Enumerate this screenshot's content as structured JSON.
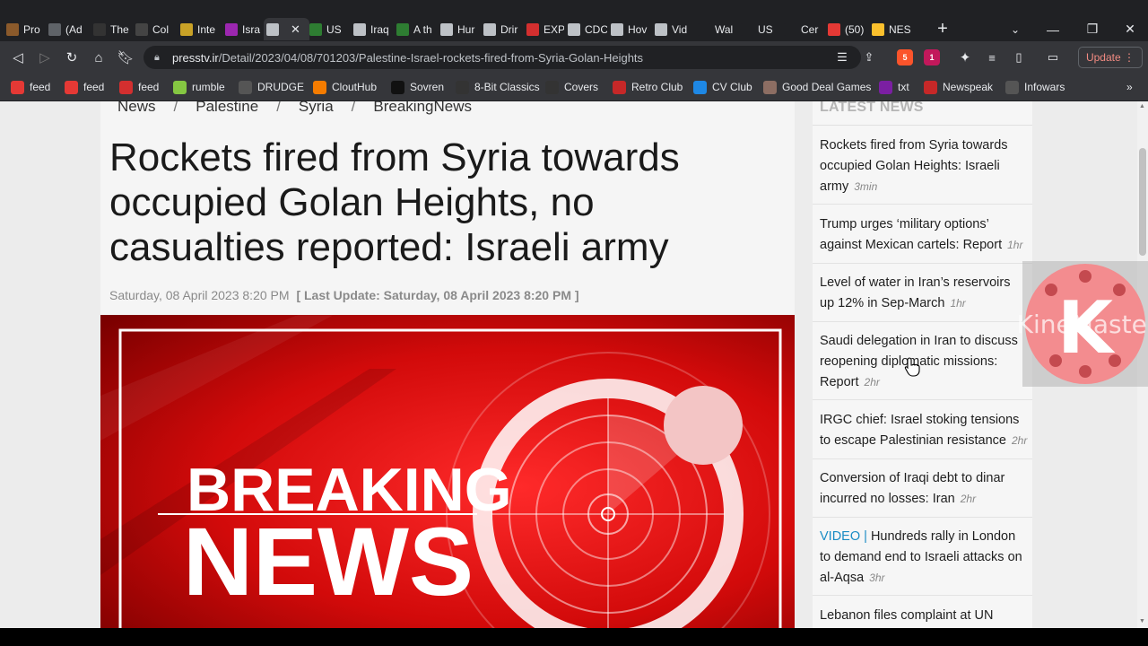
{
  "tabs": [
    {
      "label": "Pro",
      "color": "#8b5a2b"
    },
    {
      "label": "(Ad",
      "color": "#5f6368"
    },
    {
      "label": "The",
      "color": "#333333"
    },
    {
      "label": "Col",
      "color": "#444444"
    },
    {
      "label": "Inte",
      "color": "#c9a227"
    },
    {
      "label": "Isra",
      "color": "#9c27b0"
    },
    {
      "label": "",
      "color": "#bdc1c6",
      "active": true
    },
    {
      "label": "US",
      "color": "#2e7d32"
    },
    {
      "label": "Iraq",
      "color": "#bdc1c6"
    },
    {
      "label": "A th",
      "color": "#2e7d32"
    },
    {
      "label": "Hur",
      "color": "#bdc1c6"
    },
    {
      "label": "Drir",
      "color": "#bdc1c6"
    },
    {
      "label": "EXP",
      "color": "#d32f2f"
    },
    {
      "label": "CDC",
      "color": "#bdc1c6"
    },
    {
      "label": "Hov",
      "color": "#bdc1c6"
    },
    {
      "label": "Vid",
      "color": "#bdc1c6"
    },
    {
      "label": "Wal",
      "color": "#202124"
    },
    {
      "label": "US",
      "color": "#202124"
    },
    {
      "label": "Cer",
      "color": "#202124"
    },
    {
      "label": "(50)",
      "color": "#e53935"
    },
    {
      "label": "NES",
      "color": "#fbc02d"
    }
  ],
  "toolbar": {
    "url_domain": "presstv.ir",
    "url_path": "/Detail/2023/04/08/701203/Palestine-Israel-rockets-fired-from-Syria-Golan-Heights",
    "update_label": "Update",
    "brave_badge": "5",
    "rewards_badge": "1"
  },
  "bookmarks": [
    {
      "label": "feed",
      "color": "#e53935"
    },
    {
      "label": "feed",
      "color": "#e53935"
    },
    {
      "label": "feed",
      "color": "#d32f2f"
    },
    {
      "label": "rumble",
      "color": "#85c742"
    },
    {
      "label": "DRUDGE",
      "color": "#555555"
    },
    {
      "label": "CloutHub",
      "color": "#f57c00"
    },
    {
      "label": "Sovren",
      "color": "#111111"
    },
    {
      "label": "8-Bit Classics",
      "color": "#333333"
    },
    {
      "label": "Covers",
      "color": "#333333"
    },
    {
      "label": "Retro Club",
      "color": "#c62828"
    },
    {
      "label": "CV Club",
      "color": "#1e88e5"
    },
    {
      "label": "Good Deal Games",
      "color": "#8d6e63"
    },
    {
      "label": "txt",
      "color": "#7b1fa2"
    },
    {
      "label": "Newspeak",
      "color": "#c62828"
    },
    {
      "label": "Infowars",
      "color": "#555555"
    }
  ],
  "article": {
    "breadcrumb": [
      "News",
      "Palestine",
      "Syria",
      "BreakingNews"
    ],
    "title": "Rockets fired from Syria towards occupied Golan Heights, no casualties reported: Israeli army",
    "date": "Saturday, 08 April 2023 8:20 PM",
    "last_update": "[ Last Update: Saturday, 08 April 2023 8:20 PM ]",
    "hero_line1": "BREAKING",
    "hero_line2": "NEWS"
  },
  "sidebar": {
    "title": "LATEST NEWS",
    "items": [
      {
        "prefix": "",
        "text": "Rockets fired from Syria towards occupied Golan Heights: Israeli army",
        "time": "3min"
      },
      {
        "prefix": "",
        "text": "Trump urges ‘military options’ against Mexican cartels: Report",
        "time": "1hr"
      },
      {
        "prefix": "",
        "text": "Level of water in Iran’s reservoirs up 12% in Sep-March",
        "time": "1hr"
      },
      {
        "prefix": "",
        "text": "Saudi delegation in Iran to discuss reopening diplomatic missions: Report",
        "time": "2hr"
      },
      {
        "prefix": "",
        "text": "IRGC chief: Israel stoking tensions to escape Palestinian resistance",
        "time": "2hr"
      },
      {
        "prefix": "",
        "text": "Conversion of Iraqi debt to dinar incurred no losses: Iran",
        "time": "2hr"
      },
      {
        "prefix": "VIDEO | ",
        "text": "Hundreds rally in London to demand end to Israeli attacks on al-Aqsa",
        "time": "3hr"
      },
      {
        "prefix": "",
        "text": "Lebanon files complaint at UN Security",
        "time": ""
      }
    ]
  },
  "watermark": {
    "letter": "K",
    "text": "KineMaster"
  }
}
